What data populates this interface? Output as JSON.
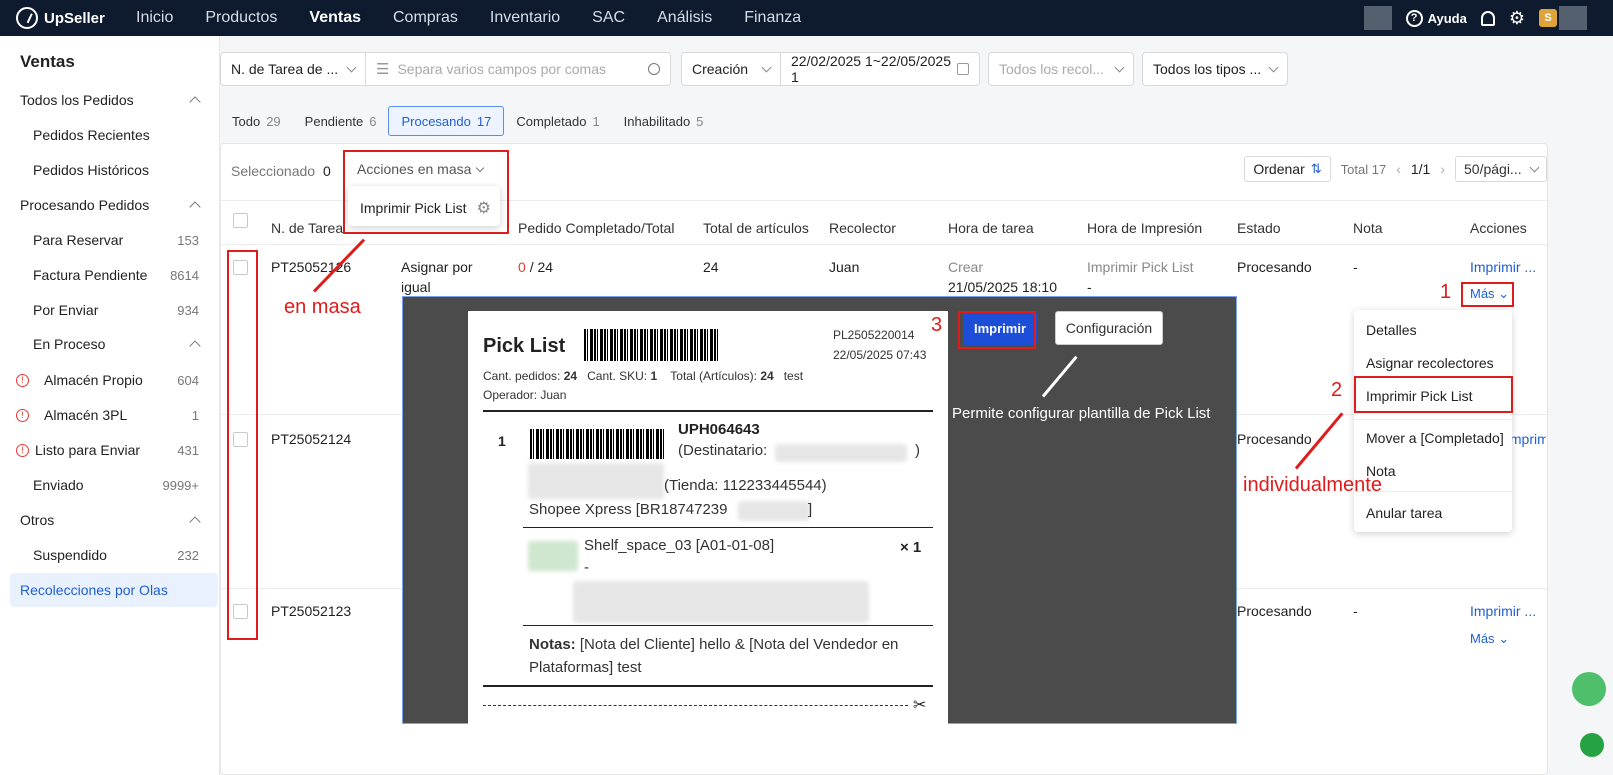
{
  "topbar": {
    "logo": "UpSeller",
    "nav": [
      "Inicio",
      "Productos",
      "Ventas",
      "Compras",
      "Inventario",
      "SAC",
      "Análisis",
      "Finanza"
    ],
    "active_nav": "Ventas",
    "help": "Ayuda",
    "badge": "S"
  },
  "sidebar": {
    "title": "Ventas",
    "items": [
      {
        "label": "Todos los Pedidos",
        "count": "",
        "type": "group"
      },
      {
        "label": "Pedidos Recientes",
        "count": ""
      },
      {
        "label": "Pedidos Históricos",
        "count": ""
      },
      {
        "label": "Procesando Pedidos",
        "count": "",
        "type": "group"
      },
      {
        "label": "Para Reservar",
        "count": "153"
      },
      {
        "label": "Factura Pendiente",
        "count": "8614"
      },
      {
        "label": "Por Enviar",
        "count": "934"
      },
      {
        "label": "En Proceso",
        "count": "",
        "type": "group"
      },
      {
        "label": "Almacén Propio",
        "count": "604"
      },
      {
        "label": "Almacén 3PL",
        "count": "1"
      },
      {
        "label": "Listo para Enviar",
        "count": "431"
      },
      {
        "label": "Enviado",
        "count": "9999+"
      },
      {
        "label": "Otros",
        "count": "",
        "type": "group"
      },
      {
        "label": "Suspendido",
        "count": "232"
      },
      {
        "label": "Recolecciones por Olas",
        "count": ""
      }
    ]
  },
  "filters": {
    "task_type": "N. de Tarea de ...",
    "search_placeholder": "Separa varios campos por comas",
    "date_type": "Creación",
    "date_range": "22/02/2025 1~22/05/2025 1",
    "collectors_placeholder": "Todos los recol...",
    "types": "Todos los tipos ..."
  },
  "status_tabs": [
    {
      "label": "Todo",
      "count": "29"
    },
    {
      "label": "Pendiente",
      "count": "6"
    },
    {
      "label": "Procesando",
      "count": "17"
    },
    {
      "label": "Completado",
      "count": "1"
    },
    {
      "label": "Inhabilitado",
      "count": "5"
    }
  ],
  "toolbar": {
    "selected_label": "Seleccionado",
    "selected_count": "0",
    "bulk_actions": "Acciones en masa",
    "bulk_print": "Imprimir Pick List",
    "order_label": "Ordenar",
    "total": "Total 17",
    "page": "1/1",
    "page_size": "50/pági..."
  },
  "table": {
    "headers": [
      "N. de Tarea",
      "Pedido Completado/Total",
      "Total de artículos",
      "Recolector",
      "Hora de tarea",
      "Hora de Impresión",
      "Estado",
      "Nota",
      "Acciones"
    ],
    "rows": [
      {
        "task": "PT25052126",
        "mode": "Asignar por igual",
        "done": "0",
        "total": "/ 24",
        "items": "24",
        "collector": "Juan",
        "time_label": "Crear",
        "time": "21/05/2025 18:10",
        "print_label": "Imprimir Pick List",
        "print_time": "-",
        "status": "Procesando",
        "note": "-",
        "action": "Imprimir ...",
        "more": "Más"
      },
      {
        "task": "PT25052124",
        "status": "Procesando",
        "action": "Imprimir ..."
      },
      {
        "task": "PT25052123",
        "status": "Procesando",
        "note": "-",
        "action": "Imprimir ...",
        "more": "Más"
      }
    ]
  },
  "more_menu": [
    "Detalles",
    "Asignar recolectores",
    "Imprimir Pick List",
    "Mover a [Completado]",
    "Nota",
    "Anular tarea"
  ],
  "preview": {
    "title": "Pick List",
    "doc_id": "PL2505220014",
    "doc_date": "22/05/2025 07:43",
    "summary_orders_label": "Cant. pedidos:",
    "summary_orders": "24",
    "summary_sku_label": "Cant. SKU:",
    "summary_sku": "1",
    "summary_total_label": "Total (Artículos):",
    "summary_total": "24",
    "summary_note": "test",
    "operator": "Operador: Juan",
    "item_index": "1",
    "package_code": "UPH064643",
    "recipient": "(Destinatario:",
    "recipient_end": ")",
    "shop": "(Tienda: 112233445544)",
    "carrier": "Shopee Xpress  [BR18747239",
    "carrier_end": "]",
    "sku_line": "Shelf_space_03 [A01-01-08]",
    "sku_dash": "-",
    "qty": "× 1",
    "notes_label": "Notas:",
    "notes_text": "[Nota del Cliente] hello & [Nota del Vendedor en Plataformas] test",
    "print_button": "Imprimir",
    "config_button": "Configuración",
    "config_caption": "Permite configurar plantilla de Pick List"
  },
  "annotations": {
    "bulk": "en masa",
    "individual": "individualmente",
    "step1": "1",
    "step2": "2",
    "step3": "3"
  },
  "colors": {
    "accent": "#1f5fd1",
    "annotation": "#e01b1b",
    "topbar": "#0e1b2e",
    "print_button": "#1d4ed8"
  }
}
